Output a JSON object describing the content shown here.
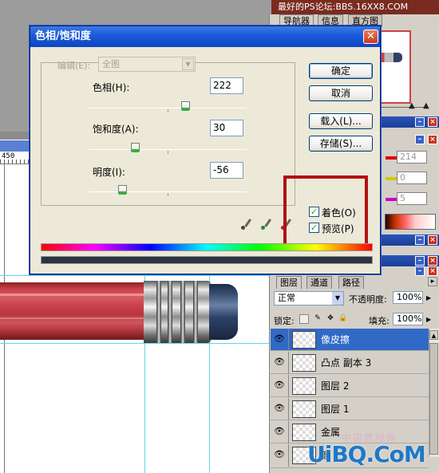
{
  "watermark_top": "最好的PS论坛:BBS.16XX8.COM",
  "canvas": {
    "ruler_value": "450"
  },
  "panels": {
    "navigator_tabs": [
      "导航器",
      "信息",
      "直方图"
    ],
    "color_values": [
      "214",
      "0",
      "5"
    ]
  },
  "layers_panel": {
    "tabs": [
      "图层",
      "通道",
      "路径"
    ],
    "blend_mode": "正常",
    "opacity_label": "不透明度:",
    "opacity_value": "100%",
    "lock_label": "锁定:",
    "fill_label": "填充:",
    "fill_value": "100%",
    "layers": [
      {
        "name": "像皮擦",
        "selected": true
      },
      {
        "name": "凸点 副本 3",
        "selected": false
      },
      {
        "name": "图层 2",
        "selected": false
      },
      {
        "name": "图层 1",
        "selected": false
      },
      {
        "name": "金属",
        "selected": false
      },
      {
        "name": "颜",
        "selected": false
      }
    ]
  },
  "site_logo": "UiBQ.CoM",
  "site_sub": "中国教程网",
  "dialog": {
    "title": "色相/饱和度",
    "edit_label": "编辑(E):",
    "edit_value": "全图",
    "hue_label": "色相(H):",
    "hue_value": "222",
    "saturation_label": "饱和度(A):",
    "saturation_value": "30",
    "lightness_label": "明度(I):",
    "lightness_value": "-56",
    "buttons": {
      "ok": "确定",
      "cancel": "取消",
      "load": "载入(L)...",
      "save": "存储(S)..."
    },
    "colorize_label": "着色(O)",
    "colorize_checked": true,
    "preview_label": "预览(P)",
    "preview_checked": true
  },
  "colors": {
    "dialog_title": "#1a5ad8",
    "highlight_box": "#b31010",
    "selected_layer": "#3169c6"
  },
  "icons": [
    "close-icon",
    "eye-icon",
    "eyedropper-icon",
    "eyedropper-plus-icon",
    "eyedropper-minus-icon",
    "lock-transparent-icon",
    "lock-brush-icon",
    "lock-move-icon",
    "lock-all-icon",
    "checkmark-icon"
  ]
}
